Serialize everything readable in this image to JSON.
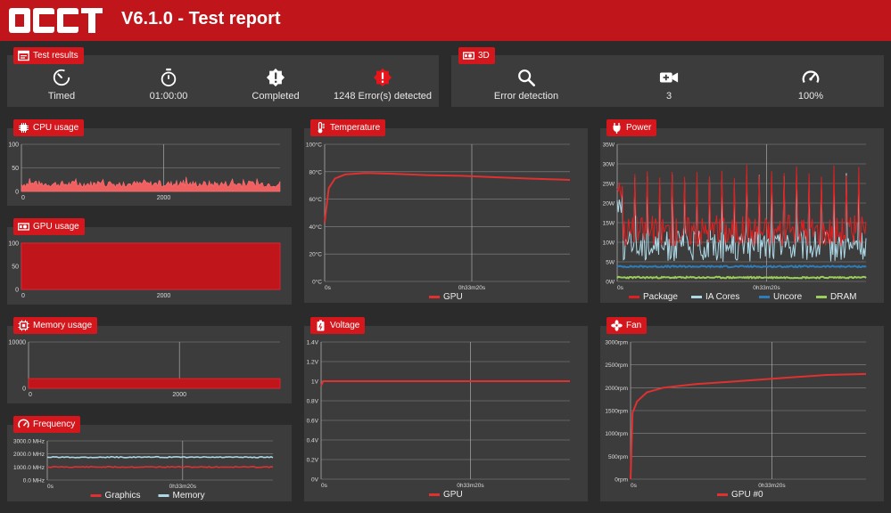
{
  "header": {
    "logo_text": "OCCT",
    "title": "V6.1.0 - Test report"
  },
  "test_results": {
    "tag": "Test results",
    "stats": [
      {
        "icon": "timer-icon",
        "label": "Timed"
      },
      {
        "icon": "stopwatch-icon",
        "label": "01:00:00"
      },
      {
        "icon": "completed-badge-icon",
        "label": "Completed"
      },
      {
        "icon": "error-badge-icon",
        "label": "1248 Error(s) detected"
      }
    ]
  },
  "test_3d": {
    "tag": "3D",
    "stats": [
      {
        "icon": "search-icon",
        "label": "Error detection"
      },
      {
        "icon": "video-camera-icon",
        "label": "3"
      },
      {
        "icon": "gauge-icon",
        "label": "100%"
      }
    ]
  },
  "colors": {
    "accent": "#c0161b",
    "panel": "#3c3c3c",
    "background": "#2b2b2b",
    "graphics": "#e03030",
    "memory": "#add8e6",
    "package": "#e02020",
    "ia_cores": "#add8e6",
    "uncore": "#2e7db8",
    "dram": "#9acd5a"
  },
  "chart_data": [
    {
      "id": "cpu",
      "tag": "CPU usage",
      "icon": "cpu-icon",
      "type": "area",
      "xlim": [
        0,
        3600
      ],
      "x_ticks": [
        "0",
        "2000"
      ],
      "y_ticks": [
        "100",
        "50",
        "0"
      ],
      "ylim": [
        0,
        100
      ],
      "series": [
        {
          "values_desc": "fluctuating",
          "mean": 16,
          "min": 6,
          "max": 32,
          "color": "#f06060"
        }
      ]
    },
    {
      "id": "gpu",
      "tag": "GPU usage",
      "icon": "gpu-icon",
      "type": "area",
      "xlim": [
        0,
        3600
      ],
      "x_ticks": [
        "0",
        "2000"
      ],
      "y_ticks": [
        "100",
        "50",
        "0"
      ],
      "ylim": [
        0,
        100
      ],
      "series": [
        {
          "constant": 100,
          "color": "#c0161b"
        }
      ]
    },
    {
      "id": "memory",
      "tag": "Memory usage",
      "icon": "memory-icon",
      "type": "area",
      "xlim": [
        0,
        3600
      ],
      "x_ticks": [
        "0",
        "2000"
      ],
      "y_ticks": [
        "10000",
        "0"
      ],
      "ylim": [
        0,
        20000
      ],
      "series": [
        {
          "constant": 4200,
          "color": "#c0161b"
        }
      ]
    },
    {
      "id": "frequency",
      "tag": "Frequency",
      "icon": "frequency-icon",
      "type": "line",
      "x_ticks": [
        "0s",
        "0h33m20s"
      ],
      "y_ticks": [
        "3000.0 MHz",
        "2000.0 MHz",
        "1000.0 MHz",
        "0.0 MHz"
      ],
      "ylim": [
        0,
        3000
      ],
      "series": [
        {
          "name": "Graphics",
          "constant": 1000,
          "color": "#e03030"
        },
        {
          "name": "Memory",
          "constant": 1750,
          "color": "#add8e6"
        }
      ]
    },
    {
      "id": "temperature",
      "tag": "Temperature",
      "icon": "thermometer-icon",
      "type": "line",
      "x_ticks": [
        "0s",
        "0h33m20s"
      ],
      "y_ticks": [
        "100°C",
        "80°C",
        "60°C",
        "40°C",
        "20°C",
        "0°C"
      ],
      "ylim": [
        0,
        100
      ],
      "series": [
        {
          "name": "GPU",
          "points": [
            [
              0,
              43
            ],
            [
              60,
              68
            ],
            [
              150,
              75
            ],
            [
              300,
              78
            ],
            [
              600,
              79
            ],
            [
              1000,
              78.5
            ],
            [
              1500,
              77.5
            ],
            [
              2000,
              77
            ],
            [
              2500,
              76
            ],
            [
              3000,
              75
            ],
            [
              3600,
              74
            ]
          ],
          "color": "#e03030"
        }
      ]
    },
    {
      "id": "voltage",
      "tag": "Voltage",
      "icon": "battery-icon",
      "type": "line",
      "x_ticks": [
        "0s",
        "0h33m20s"
      ],
      "y_ticks": [
        "1.4V",
        "1.2V",
        "1V",
        "0.8V",
        "0.6V",
        "0.4V",
        "0.2V",
        "0V"
      ],
      "ylim": [
        0,
        1.4
      ],
      "series": [
        {
          "name": "GPU",
          "points": [
            [
              0,
              0.95
            ],
            [
              30,
              1
            ],
            [
              3600,
              1
            ]
          ],
          "color": "#e03030"
        }
      ]
    },
    {
      "id": "power",
      "tag": "Power",
      "icon": "plug-icon",
      "type": "line",
      "x_ticks": [
        "0s",
        "0h33m20s"
      ],
      "y_ticks": [
        "35W",
        "30W",
        "25W",
        "20W",
        "15W",
        "10W",
        "5W",
        "0W"
      ],
      "ylim": [
        0,
        35
      ],
      "series": [
        {
          "name": "Package",
          "mean": 13,
          "spike_to": 30,
          "color": "#e02020"
        },
        {
          "name": "IA Cores",
          "mean": 9,
          "spike_to": 28,
          "color": "#add8e6"
        },
        {
          "name": "Uncore",
          "constant": 3.8,
          "color": "#2e7db8"
        },
        {
          "name": "DRAM",
          "constant": 1,
          "color": "#9acd5a"
        }
      ]
    },
    {
      "id": "fan",
      "tag": "Fan",
      "icon": "fan-icon",
      "type": "line",
      "x_ticks": [
        "0s",
        "0h33m20s"
      ],
      "y_ticks": [
        "3000rpm",
        "2500rpm",
        "2000rpm",
        "1500rpm",
        "1000rpm",
        "500rpm",
        "0rpm"
      ],
      "ylim": [
        0,
        3000
      ],
      "series": [
        {
          "name": "GPU #0",
          "points": [
            [
              0,
              0
            ],
            [
              30,
              1450
            ],
            [
              100,
              1700
            ],
            [
              250,
              1900
            ],
            [
              500,
              2000
            ],
            [
              1000,
              2080
            ],
            [
              1500,
              2130
            ],
            [
              2000,
              2180
            ],
            [
              2500,
              2230
            ],
            [
              3000,
              2280
            ],
            [
              3600,
              2300
            ]
          ],
          "color": "#e03030"
        }
      ]
    }
  ]
}
